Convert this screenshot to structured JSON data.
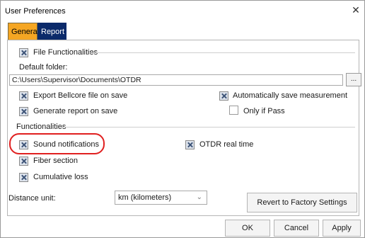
{
  "window": {
    "title": "User Preferences",
    "close_glyph": "✕"
  },
  "tabs": [
    {
      "label": "General",
      "active": true
    },
    {
      "label": "Report",
      "active": false
    }
  ],
  "file_functionalities": {
    "label": "File Functionalities",
    "checked": true,
    "default_folder_label": "Default folder:",
    "default_folder_value": "C:\\Users\\Supervisor\\Documents\\OTDR",
    "browse_label": "...",
    "options": [
      {
        "label": "Export Bellcore file on save",
        "checked": true
      },
      {
        "label": "Automatically save measurement",
        "checked": true
      },
      {
        "label": "Generate report on save",
        "checked": true
      },
      {
        "label": "Only if Pass",
        "checked": false
      }
    ]
  },
  "functionalities": {
    "label": "Functionalities",
    "options": [
      {
        "label": "Sound notifications",
        "checked": true
      },
      {
        "label": "OTDR real time",
        "checked": true
      },
      {
        "label": "Fiber section",
        "checked": true
      },
      {
        "label": "Cumulative loss",
        "checked": true
      }
    ]
  },
  "distance_unit": {
    "label": "Distance unit:",
    "selected": "km (kilometers)"
  },
  "buttons": {
    "factory": "Revert to Factory Settings",
    "ok": "OK",
    "cancel": "Cancel",
    "apply": "Apply"
  },
  "colors": {
    "general_tab": "#f5a623",
    "report_tab": "#0b2a6a",
    "highlight": "#e02020"
  }
}
